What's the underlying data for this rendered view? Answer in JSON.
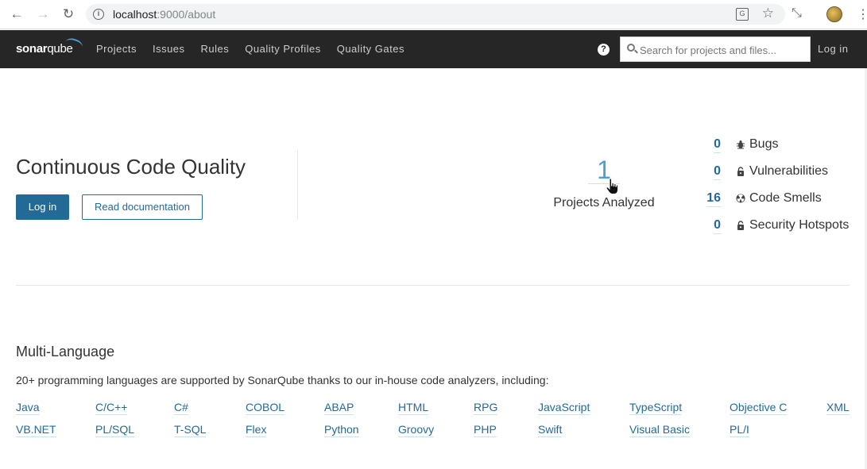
{
  "browser": {
    "url_host": "localhost",
    "url_rest": ":9000/about",
    "back_icon": "arrow-left-icon",
    "forward_icon": "arrow-right-icon",
    "reload_icon": "reload-icon"
  },
  "nav": {
    "logo_bold": "sonar",
    "logo_thin": "qube",
    "links": [
      "Projects",
      "Issues",
      "Rules",
      "Quality Profiles",
      "Quality Gates"
    ],
    "help": "?",
    "search_placeholder": "Search for projects and files...",
    "login": "Log in"
  },
  "hero": {
    "title": "Continuous Code Quality",
    "login_button": "Log in",
    "docs_button": "Read documentation",
    "projects_count": "1",
    "projects_label": "Projects Analyzed",
    "stats": [
      {
        "value": "0",
        "label": "Bugs",
        "icon": "bug-icon"
      },
      {
        "value": "0",
        "label": "Vulnerabilities",
        "icon": "lock-icon"
      },
      {
        "value": "16",
        "label": "Code Smells",
        "icon": "code-smell-icon"
      },
      {
        "value": "0",
        "label": "Security Hotspots",
        "icon": "lock-icon"
      }
    ]
  },
  "multi_language": {
    "title": "Multi-Language",
    "description": "20+ programming languages are supported by SonarQube thanks to our in-house code analyzers, including:",
    "row1": [
      "Java",
      "C/C++",
      "C#",
      "COBOL",
      "ABAP",
      "HTML",
      "RPG",
      "JavaScript",
      "TypeScript",
      "Objective C",
      "XML"
    ],
    "row2": [
      "VB.NET",
      "PL/SQL",
      "T-SQL",
      "Flex",
      "Python",
      "Groovy",
      "PHP",
      "Swift",
      "Visual Basic",
      "PL/I"
    ]
  },
  "colors": {
    "nav_bg": "#262626",
    "accent": "#236a97",
    "link_light": "#4b9fd5"
  }
}
